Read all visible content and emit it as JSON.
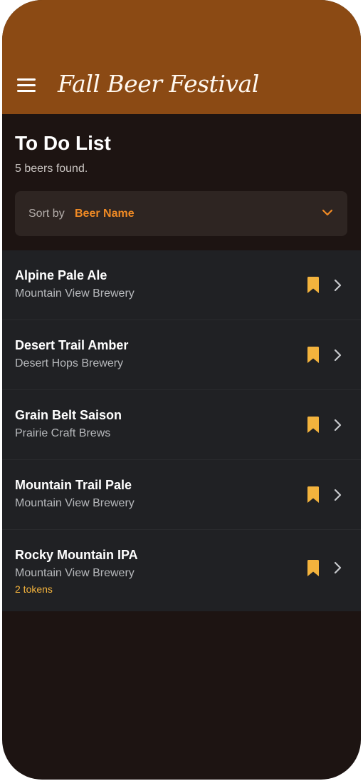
{
  "header": {
    "app_title": "Fall Beer Festival",
    "menu_icon": "hamburger-menu-icon",
    "background_color": "#8b4a14"
  },
  "page": {
    "title": "To Do List",
    "result_count": "5 beers found."
  },
  "sort": {
    "label": "Sort by",
    "value": "Beer Name",
    "icon": "chevron-down-icon",
    "accent_color": "#f08a24"
  },
  "beers": [
    {
      "name": "Alpine Pale Ale",
      "brewery": "Mountain View Brewery",
      "tokens": ""
    },
    {
      "name": "Desert Trail Amber",
      "brewery": "Desert Hops Brewery",
      "tokens": ""
    },
    {
      "name": "Grain Belt Saison",
      "brewery": "Prairie Craft Brews",
      "tokens": ""
    },
    {
      "name": "Mountain Trail Pale",
      "brewery": "Mountain View Brewery",
      "tokens": ""
    },
    {
      "name": "Rocky Mountain IPA",
      "brewery": "Mountain View Brewery",
      "tokens": "2 tokens"
    }
  ],
  "row_icons": {
    "bookmark": "bookmark-icon",
    "chevron": "chevron-right-icon",
    "bookmark_color": "#f3b33d"
  }
}
